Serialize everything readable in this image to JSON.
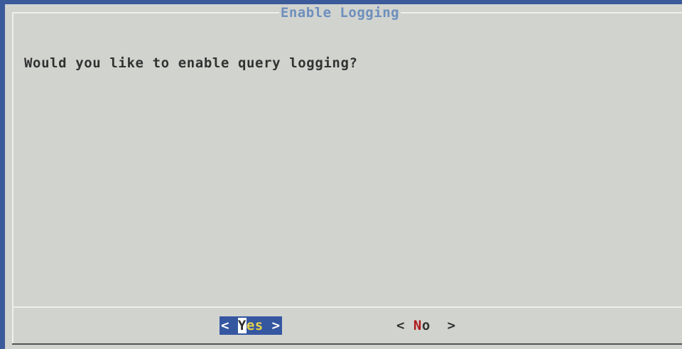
{
  "dialog": {
    "title": "Enable Logging",
    "message": "Would you like to enable query logging?"
  },
  "buttons": {
    "yes": {
      "open": "< ",
      "hotkey": "Y",
      "rest": "es",
      "close": " >"
    },
    "no": {
      "open": "< ",
      "hotkey": "N",
      "rest": "o",
      "close": "  >"
    }
  },
  "colors": {
    "screen_background": "#3b5a9a",
    "dialog_background": "#d1d3cf",
    "title_text": "#6e8fbd",
    "selected_button": "#3457a0",
    "hotkey_red": "#b01a1a",
    "selected_label": "#e8d24a"
  }
}
